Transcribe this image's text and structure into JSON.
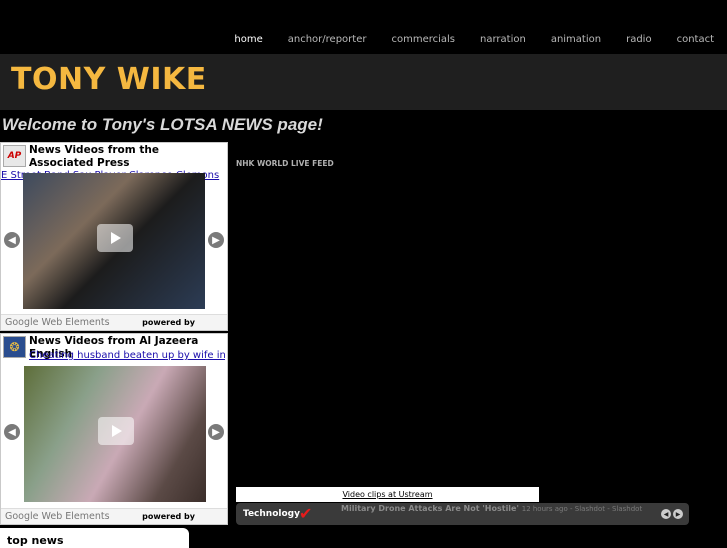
{
  "nav": [
    "home",
    "anchor/reporter",
    "commercials",
    "narration",
    "animation",
    "radio",
    "contact"
  ],
  "site_title": "TONY WIKE",
  "welcome": "Welcome to Tony's LOTSA NEWS page!",
  "widget_ap": {
    "logo": "AP",
    "title": "News Videos from the Associated Press",
    "link": "E Street Band Sax Player Clarence Clemons",
    "footer_brand": "Google Web Elements",
    "powered": "powered by"
  },
  "widget_aj": {
    "logo": "❂",
    "title": "News Videos from Al Jazeera English",
    "link": "Cheating husband beaten up by wife in",
    "footer_brand": "Google Web Elements",
    "powered": "powered by"
  },
  "nhk_label": "NHK WORLD LIVE FEED",
  "ustream_link": "Video clips at Ustream",
  "ticker": {
    "category": "Technology",
    "headline": "Military Drone Attacks Are Not 'Hostile'",
    "meta": "12 hours ago - Slashdot - Slashdot"
  },
  "top_news": "top news"
}
